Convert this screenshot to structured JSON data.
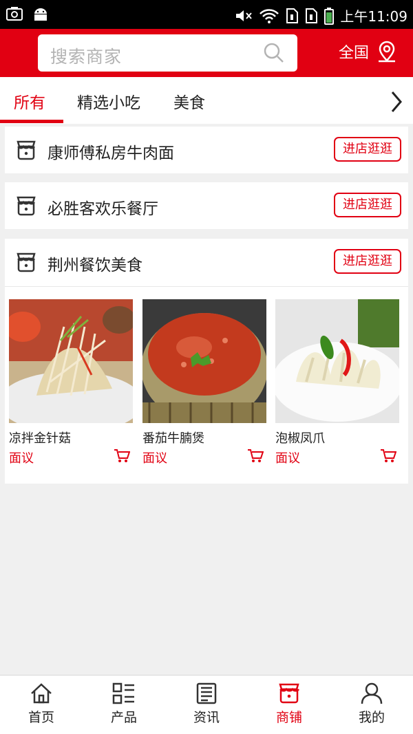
{
  "status_bar": {
    "time": "上午11:09"
  },
  "header": {
    "search_placeholder": "搜索商家",
    "region": "全国"
  },
  "tabs": [
    {
      "label": "所有",
      "active": true
    },
    {
      "label": "精选小吃",
      "active": false
    },
    {
      "label": "美食",
      "active": false
    }
  ],
  "stores": [
    {
      "name": "康师傅私房牛肉面",
      "button": "进店逛逛"
    },
    {
      "name": "必胜客欢乐餐厅",
      "button": "进店逛逛"
    },
    {
      "name": "荆州餐饮美食",
      "button": "进店逛逛",
      "products": [
        {
          "name": "凉拌金针菇",
          "price": "面议"
        },
        {
          "name": "番茄牛腩煲",
          "price": "面议"
        },
        {
          "name": "泡椒凤爪",
          "price": "面议"
        }
      ]
    }
  ],
  "bottom_nav": [
    {
      "label": "首页",
      "icon": "home-icon",
      "active": false
    },
    {
      "label": "产品",
      "icon": "grid-list-icon",
      "active": false
    },
    {
      "label": "资讯",
      "icon": "news-icon",
      "active": false
    },
    {
      "label": "商铺",
      "icon": "shop-icon",
      "active": true
    },
    {
      "label": "我的",
      "icon": "user-icon",
      "active": false
    }
  ],
  "colors": {
    "brand": "#e10012",
    "background": "#f0f0f0"
  }
}
